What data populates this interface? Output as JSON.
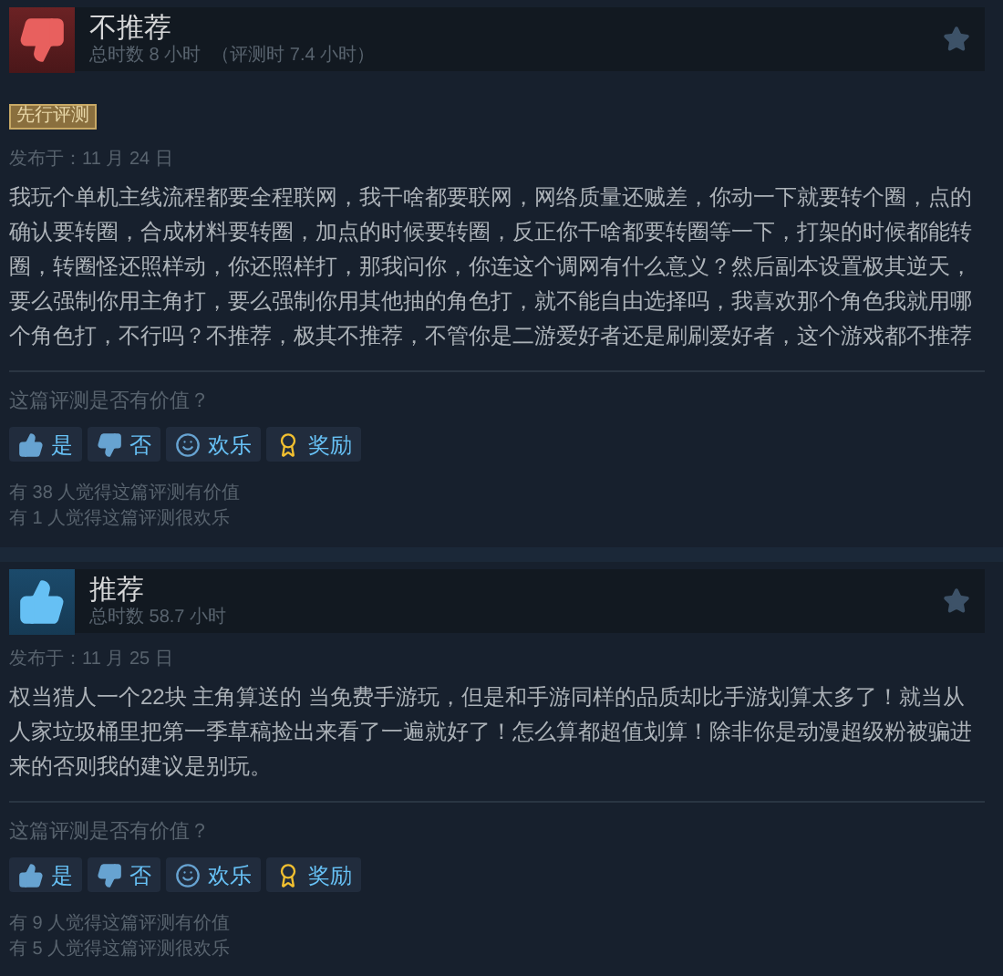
{
  "reviews": [
    {
      "kind": "negative",
      "title": "不推荐",
      "hours": "总时数 8 小时",
      "hours_at_review": "（评测时 7.4 小时）",
      "badge": "先行评测",
      "date": "发布于：11 月 24 日",
      "body": "我玩个单机主线流程都要全程联网，我干啥都要联网，网络质量还贼差，你动一下就要转个圈，点的确认要转圈，合成材料要转圈，加点的时候要转圈，反正你干啥都要转圈等一下，打架的时候都能转圈，转圈怪还照样动，你还照样打，那我问你，你连这个调网有什么意义？然后副本设置极其逆天，要么强制你用主角打，要么强制你用其他抽的角色打，就不能自由选择吗，我喜欢那个角色我就用哪个角色打，不行吗？不推荐，极其不推荐，不管你是二游爱好者还是刷刷爱好者，这个游戏都不推荐",
      "question": "这篇评测是否有价值？",
      "buttons": [
        {
          "kind": "yes",
          "label": "是"
        },
        {
          "kind": "no",
          "label": "否"
        },
        {
          "kind": "funny",
          "label": "欢乐"
        },
        {
          "kind": "award",
          "label": "奖励"
        }
      ],
      "stats": [
        "有 38 人觉得这篇评测有价值",
        "有 1 人觉得这篇评测很欢乐"
      ]
    },
    {
      "kind": "positive",
      "title": "推荐",
      "hours": "总时数 58.7 小时",
      "date": "发布于：11 月 25 日",
      "body": "权当猎人一个22块 主角算送的 当免费手游玩，但是和手游同样的品质却比手游划算太多了！就当从人家垃圾桶里把第一季草稿捡出来看了一遍就好了！怎么算都超值划算！除非你是动漫超级粉被骗进来的否则我的建议是别玩。",
      "question": "这篇评测是否有价值？",
      "buttons": [
        {
          "kind": "yes",
          "label": "是"
        },
        {
          "kind": "no",
          "label": "否"
        },
        {
          "kind": "funny",
          "label": "欢乐"
        },
        {
          "kind": "award",
          "label": "奖励"
        }
      ],
      "stats": [
        "有 9 人觉得这篇评测有价值",
        "有 5 人觉得这篇评测很欢乐"
      ]
    }
  ]
}
